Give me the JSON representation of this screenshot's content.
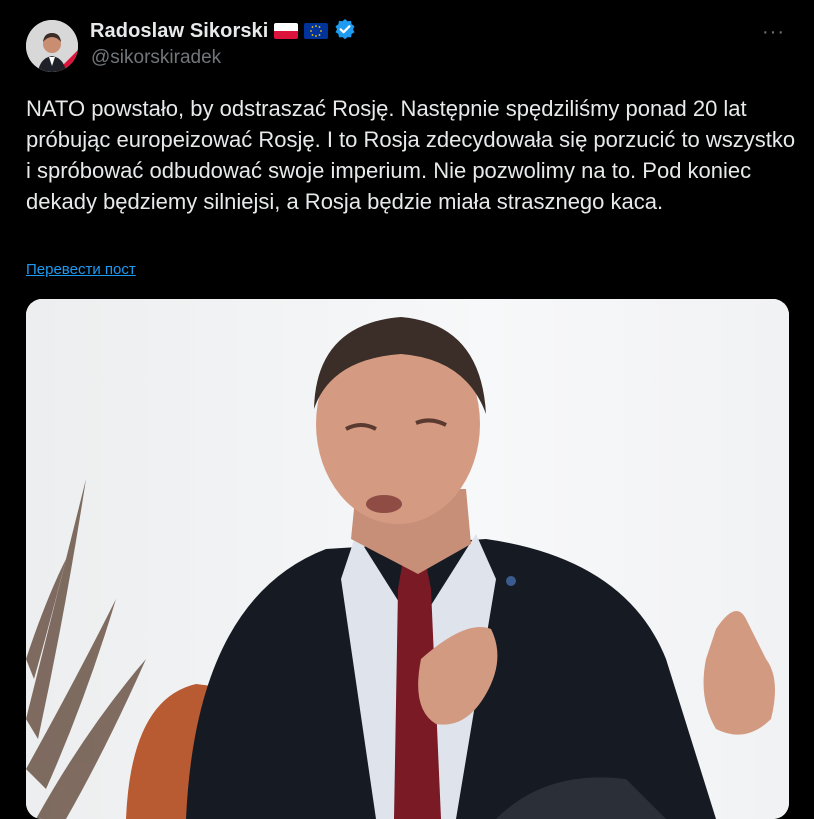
{
  "author": {
    "display_name": "Radoslaw Sikorski",
    "handle": "@sikorskiradek",
    "badges": [
      "poland-flag-icon",
      "eu-flag-icon",
      "verified-badge-icon"
    ]
  },
  "more_menu_icon": "more-options-icon",
  "post": {
    "text": "NATO powstało, by odstraszać Rosję. Następnie spędziliśmy ponad 20 lat próbując europeizować Rosję. I to Rosja zdecydowała się porzucić to wszystko i spróbować odbudować swoje imperium. Nie pozwolimy na to. Pod koniec dekady będziemy silniejsi, a Rosja będzie miała strasznego kaca.",
    "translate_link": "Перевести пост"
  },
  "colors": {
    "background": "#000000",
    "text": "#e7e9ea",
    "secondary_text": "#71767b",
    "link": "#1d9bf0",
    "verified": "#1d9bf0"
  }
}
